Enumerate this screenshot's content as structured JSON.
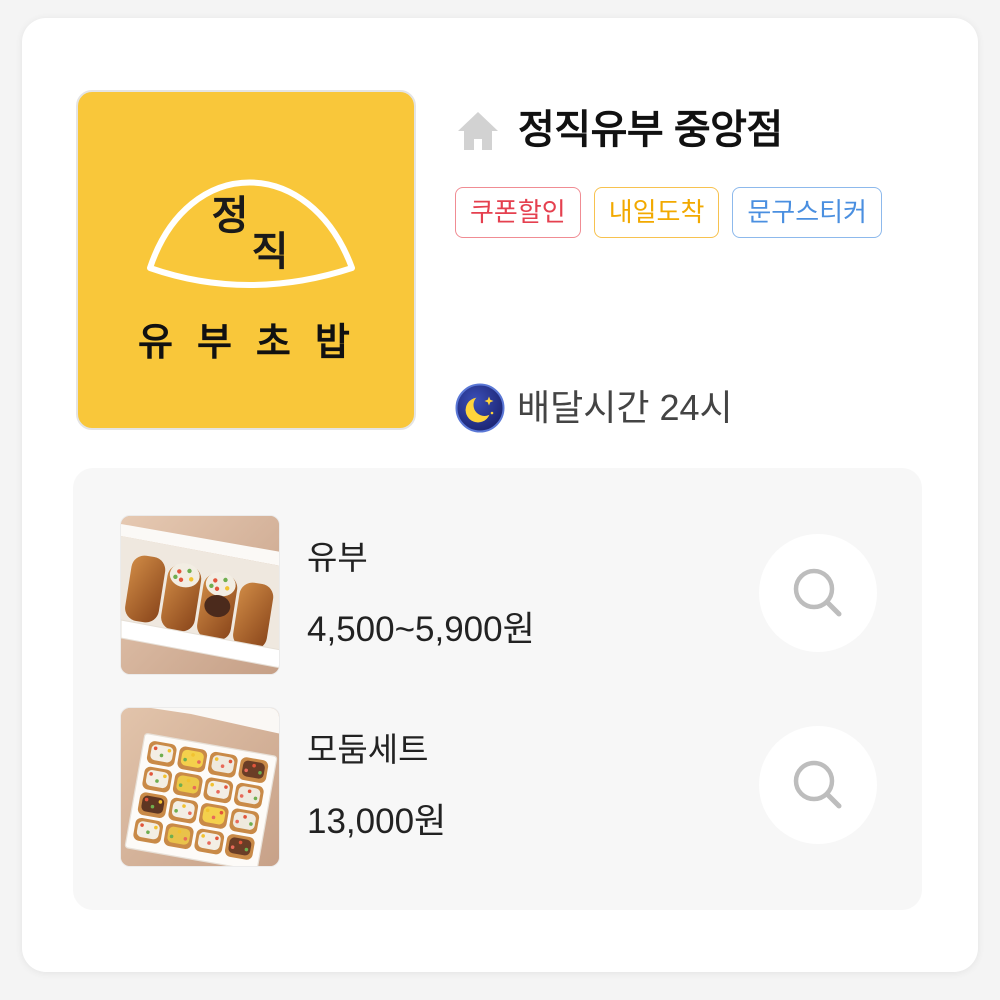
{
  "icons": {
    "home": "home-icon",
    "moon": "moon-icon",
    "search": "search-icon"
  },
  "store": {
    "name": "정직유부 중앙점",
    "logo": {
      "mark": [
        "정",
        "직"
      ],
      "wordmark": "유부초밥",
      "background": "#F9C73A"
    },
    "tags": [
      {
        "label": "쿠폰할인",
        "color": "#E5404F",
        "border": "#F08C93"
      },
      {
        "label": "내일도착",
        "color": "#F2A900",
        "border": "#F7C24F"
      },
      {
        "label": "문구스티커",
        "color": "#4A8FE0",
        "border": "#8DB9EC"
      }
    ],
    "delivery_hours": "배달시간 24시"
  },
  "menu": [
    {
      "name": "유부",
      "price": "4,500~5,900원"
    },
    {
      "name": "모둠세트",
      "price": "13,000원"
    }
  ]
}
